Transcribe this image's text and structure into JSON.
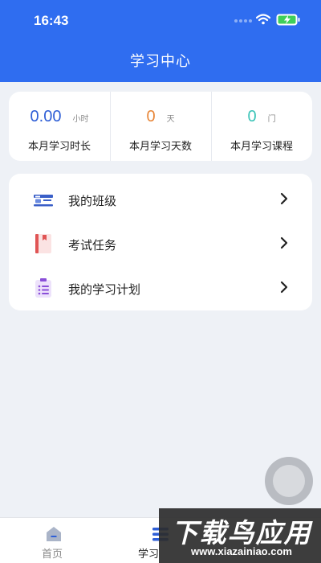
{
  "status_bar": {
    "time": "16:43"
  },
  "header": {
    "title": "学习中心"
  },
  "stats": [
    {
      "value": "0.00",
      "unit": "小时",
      "label": "本月学习时长",
      "color": "#2f5fd6"
    },
    {
      "value": "0",
      "unit": "天",
      "label": "本月学习天数",
      "color": "#e8873a"
    },
    {
      "value": "0",
      "unit": "门",
      "label": "本月学习课程",
      "color": "#3cc4b8"
    }
  ],
  "menu": [
    {
      "label": "我的班级",
      "icon": "id-card-icon"
    },
    {
      "label": "考试任务",
      "icon": "book-icon"
    },
    {
      "label": "我的学习计划",
      "icon": "clipboard-list-icon"
    }
  ],
  "tabbar": [
    {
      "label": "首页",
      "icon": "home-icon"
    },
    {
      "label": "学习",
      "icon": "list-icon"
    }
  ],
  "watermark": {
    "title": "下载鸟应用",
    "url": "www.xiazainiao.com"
  },
  "colors": {
    "primary": "#2f6df0",
    "background": "#eef1f6"
  }
}
